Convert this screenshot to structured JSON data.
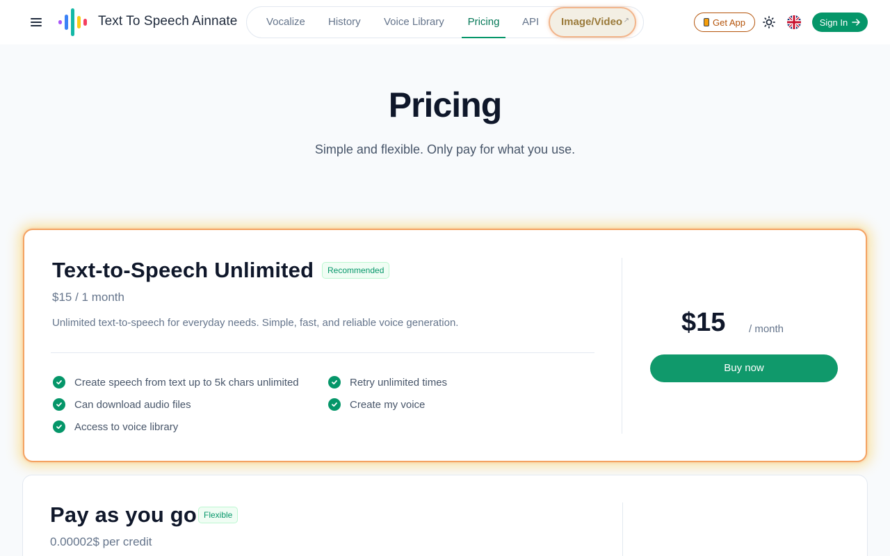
{
  "header": {
    "brand": "Text To Speech Ainnate",
    "nav": [
      {
        "label": "Vocalize"
      },
      {
        "label": "History"
      },
      {
        "label": "Voice Library"
      },
      {
        "label": "Pricing"
      },
      {
        "label": "API"
      },
      {
        "label": "Image/Video"
      }
    ],
    "get_app_label": "Get App",
    "sign_in_label": "Sign In",
    "active_nav": "Pricing"
  },
  "hero": {
    "title": "Pricing",
    "subtitle": "Simple and flexible. Only pay for what you use."
  },
  "plans": [
    {
      "name": "Text-to-Speech Unlimited",
      "badge": "Recommended",
      "price_line": "$15 / 1 month",
      "description": "Unlimited text-to-speech for everyday needs. Simple, fast, and reliable voice generation.",
      "features": [
        "Create speech from text up to 5k chars unlimited",
        "Retry unlimited times",
        "Can download audio files",
        "Create my voice",
        "Access to voice library"
      ],
      "big_price": "$15",
      "period": "/ month",
      "cta": "Buy now"
    },
    {
      "name": "Pay as you go",
      "badge": "Flexible",
      "price_line": "0.00002$ per credit"
    }
  ],
  "colors": {
    "accent": "#059669",
    "buy_button": "#10996b",
    "featured_border": "#f4a261",
    "get_app": "#b45309"
  }
}
